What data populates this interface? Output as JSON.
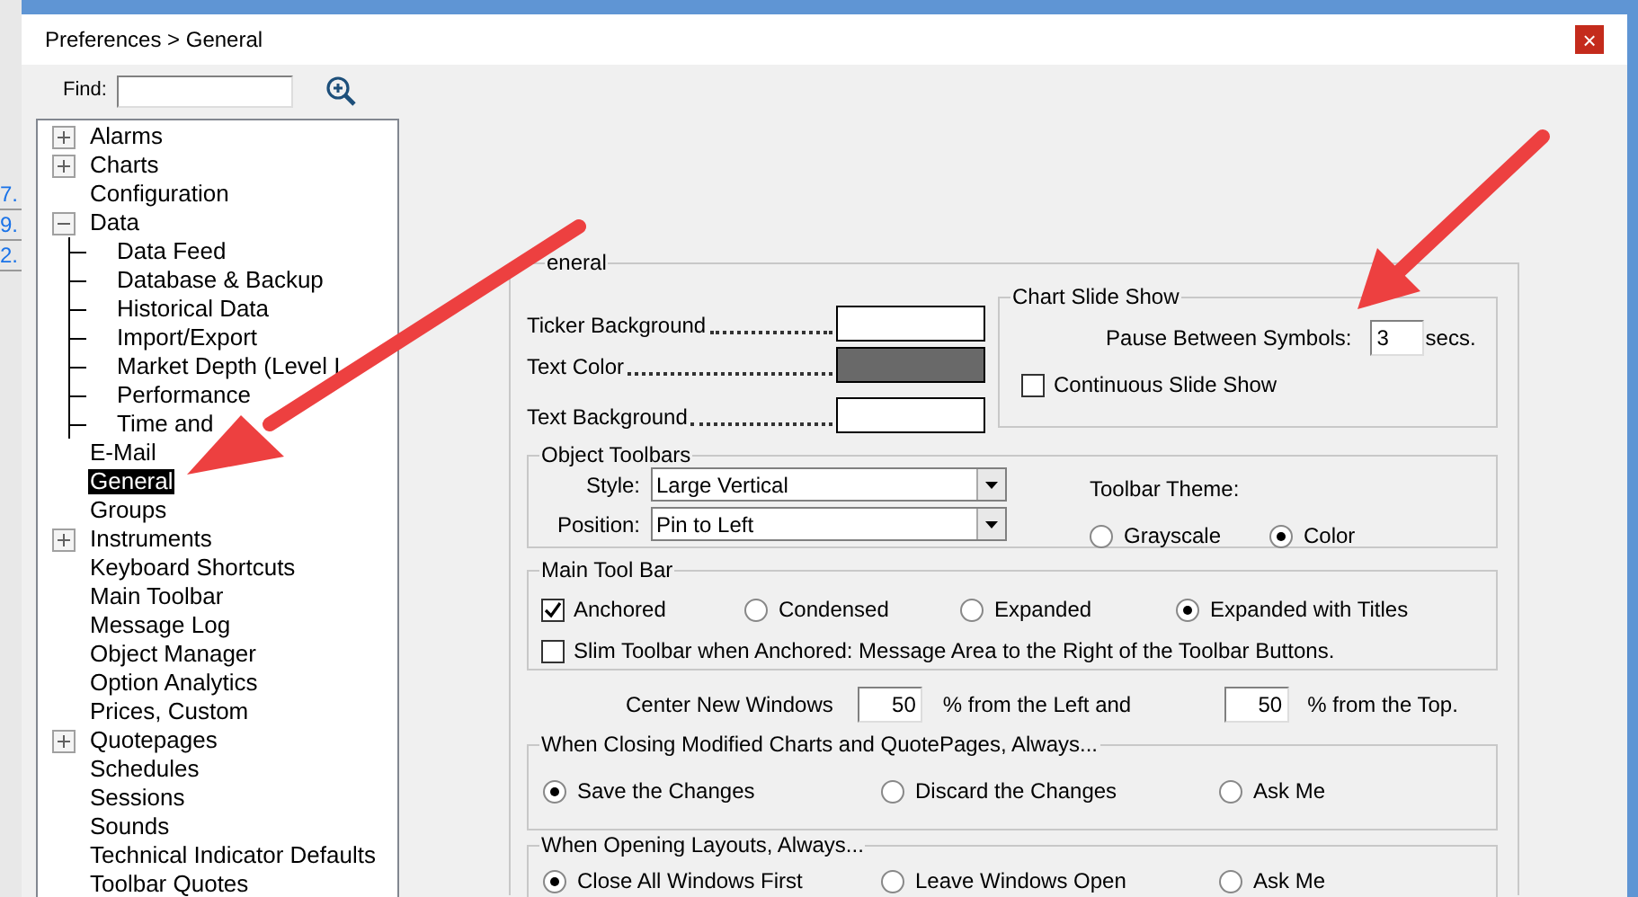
{
  "background_app": {
    "cells": [
      "7.",
      "9.",
      "2."
    ]
  },
  "window": {
    "title": "Preferences > General",
    "close": "×"
  },
  "find": {
    "label": "Find:"
  },
  "tree": [
    {
      "label": "Alarms",
      "kind": "folder",
      "expanded": false,
      "selected": false
    },
    {
      "label": "Charts",
      "kind": "folder",
      "expanded": false,
      "selected": false
    },
    {
      "label": "Configuration",
      "kind": "leaf",
      "selected": false
    },
    {
      "label": "Data",
      "kind": "folder",
      "expanded": true,
      "selected": false,
      "children": [
        {
          "label": "Data Feed",
          "selected": false
        },
        {
          "label": "Database & Backup",
          "selected": false
        },
        {
          "label": "Historical Data",
          "selected": false
        },
        {
          "label": "Import/Export",
          "selected": false
        },
        {
          "label": "Market Depth (Level I",
          "selected": false
        },
        {
          "label": "Performance",
          "selected": false
        },
        {
          "label": "Time and",
          "selected": false
        }
      ]
    },
    {
      "label": "E-Mail",
      "kind": "leaf",
      "selected": false
    },
    {
      "label": "General",
      "kind": "leaf",
      "selected": true
    },
    {
      "label": "Groups",
      "kind": "leaf",
      "selected": false
    },
    {
      "label": "Instruments",
      "kind": "folder",
      "expanded": false,
      "selected": false
    },
    {
      "label": "Keyboard Shortcuts",
      "kind": "leaf",
      "selected": false
    },
    {
      "label": "Main Toolbar",
      "kind": "leaf",
      "selected": false
    },
    {
      "label": "Message Log",
      "kind": "leaf",
      "selected": false
    },
    {
      "label": "Object Manager",
      "kind": "leaf",
      "selected": false
    },
    {
      "label": "Option Analytics",
      "kind": "leaf",
      "selected": false
    },
    {
      "label": "Prices, Custom",
      "kind": "leaf",
      "selected": false
    },
    {
      "label": "Quotepages",
      "kind": "folder",
      "expanded": false,
      "selected": false
    },
    {
      "label": "Schedules",
      "kind": "leaf",
      "selected": false
    },
    {
      "label": "Sessions",
      "kind": "leaf",
      "selected": false
    },
    {
      "label": "Sounds",
      "kind": "leaf",
      "selected": false
    },
    {
      "label": "Technical Indicator Defaults",
      "kind": "leaf",
      "selected": false
    },
    {
      "label": "Toolbar Quotes",
      "kind": "leaf",
      "selected": false
    }
  ],
  "general": {
    "title": "eneral",
    "colors": [
      {
        "label": "Ticker Background",
        "color": "#ffffff"
      },
      {
        "label": "Text Color",
        "color": "#696969"
      },
      {
        "label": "Text Background",
        "color": "#ffffff"
      }
    ],
    "slide_show": {
      "title": "Chart Slide Show",
      "pause_label": "Pause Between Symbols:",
      "pause_value": "3",
      "unit": "secs.",
      "continuous": {
        "label": "Continuous Slide Show",
        "checked": false
      }
    },
    "object_toolbars": {
      "title": "Object Toolbars",
      "style_label": "Style:",
      "style_value": "Large Vertical",
      "position_label": "Position:",
      "position_value": "Pin to Left",
      "theme_label": "Toolbar Theme:",
      "theme_options": [
        {
          "label": "Grayscale",
          "selected": false
        },
        {
          "label": "Color",
          "selected": true
        }
      ]
    },
    "main_tool_bar": {
      "title": "Main Tool Bar",
      "anchored": {
        "label": "Anchored",
        "checked": true
      },
      "options": [
        {
          "label": "Condensed",
          "selected": false
        },
        {
          "label": "Expanded",
          "selected": false
        },
        {
          "label": "Expanded with Titles",
          "selected": true
        }
      ],
      "slim": {
        "label": "Slim Toolbar when Anchored: Message Area to the Right of the Toolbar Buttons.",
        "checked": false
      }
    },
    "center": {
      "label": "Center New Windows",
      "left_value": "50",
      "left_label": "% from the Left and",
      "top_value": "50",
      "top_label": "% from the Top."
    },
    "closing": {
      "title": "When Closing Modified Charts and QuotePages, Always...",
      "options": [
        {
          "label": "Save the Changes",
          "selected": true
        },
        {
          "label": "Discard the Changes",
          "selected": false
        },
        {
          "label": "Ask Me",
          "selected": false
        }
      ]
    },
    "opening": {
      "title": "When Opening Layouts, Always...",
      "options": [
        {
          "label": "Close All Windows First",
          "selected": true
        },
        {
          "label": "Leave Windows Open",
          "selected": false
        },
        {
          "label": "Ask Me",
          "selected": false
        }
      ]
    }
  }
}
